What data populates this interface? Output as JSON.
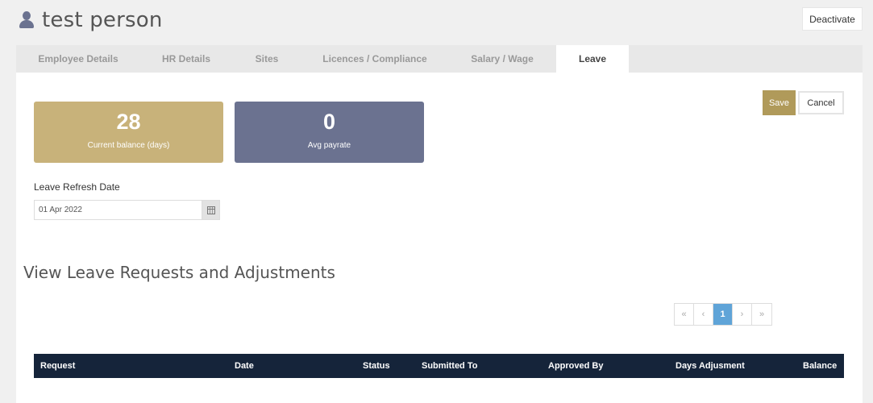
{
  "header": {
    "title": "test person",
    "user_icon": "user-icon",
    "deactivate_label": "Deactivate"
  },
  "tabs": [
    {
      "label": "Employee Details",
      "active": false
    },
    {
      "label": "HR Details",
      "active": false
    },
    {
      "label": "Sites",
      "active": false
    },
    {
      "label": "Licences / Compliance",
      "active": false
    },
    {
      "label": "Salary / Wage",
      "active": false
    },
    {
      "label": "Leave",
      "active": true
    }
  ],
  "stats": {
    "balance": {
      "value": "28",
      "label": "Current balance (days)"
    },
    "payrate": {
      "value": "0",
      "label": "Avg payrate"
    }
  },
  "actions": {
    "save_label": "Save",
    "cancel_label": "Cancel"
  },
  "leave_refresh": {
    "label": "Leave Refresh Date",
    "value": "01 Apr 2022",
    "calendar_icon": "calendar-icon"
  },
  "requests": {
    "title": "View Leave Requests and Adjustments",
    "pagination": {
      "first": "«",
      "prev": "‹",
      "current": "1",
      "next": "›",
      "last": "»"
    },
    "columns": [
      "Request",
      "Date",
      "Status",
      "Submitted To",
      "Approved By",
      "Days Adjusment",
      "Balance"
    ]
  },
  "colors": {
    "balance_card": "#c8b27a",
    "payrate_card": "#6b7290",
    "save_button": "#b09a5a",
    "table_header": "#15243a",
    "pagination_active": "#5fa4d8"
  }
}
